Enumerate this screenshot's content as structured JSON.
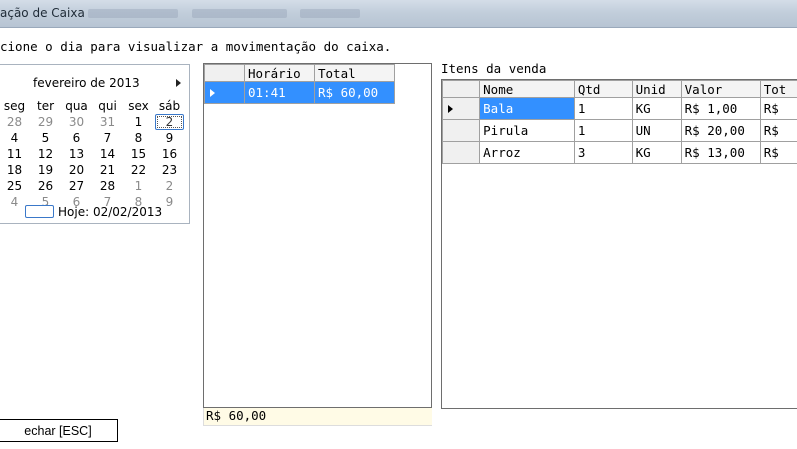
{
  "window": {
    "title": "ação de Caixa"
  },
  "instruction": "cione o dia para visualizar a movimentação do caixa.",
  "calendar": {
    "month_label": "fevereiro de 2013",
    "weekdays": [
      "seg",
      "ter",
      "qua",
      "qui",
      "sex",
      "sáb"
    ],
    "weeks": [
      [
        "28",
        "29",
        "30",
        "31",
        "1",
        "2"
      ],
      [
        "4",
        "5",
        "6",
        "7",
        "8",
        "9"
      ],
      [
        "11",
        "12",
        "13",
        "14",
        "15",
        "16"
      ],
      [
        "18",
        "19",
        "20",
        "21",
        "22",
        "23"
      ],
      [
        "25",
        "26",
        "27",
        "28",
        "1",
        "2"
      ],
      [
        "4",
        "5",
        "6",
        "7",
        "8",
        "9"
      ]
    ],
    "today_label": "Hoje: 02/02/2013"
  },
  "vendas": {
    "columns": [
      "Horário",
      "Total"
    ],
    "rows": [
      {
        "horario": "01:41",
        "total": "R$ 60,00"
      }
    ],
    "footer_total": "R$ 60,00"
  },
  "itens": {
    "label": "Itens da venda",
    "columns": [
      "Nome",
      "Qtd",
      "Unid",
      "Valor",
      "Tot"
    ],
    "rows": [
      {
        "nome": "Bala",
        "qtd": "1",
        "unid": "KG",
        "valor": "R$ 1,00",
        "tot": "R$"
      },
      {
        "nome": "Pirula",
        "qtd": "1",
        "unid": "UN",
        "valor": "R$ 20,00",
        "tot": "R$"
      },
      {
        "nome": "Arroz",
        "qtd": "3",
        "unid": "KG",
        "valor": "R$ 13,00",
        "tot": "R$"
      }
    ]
  },
  "buttons": {
    "fechar": "echar [ESC]"
  },
  "colors": {
    "selection": "#3390ff",
    "footer_bg": "#fffbe6"
  }
}
